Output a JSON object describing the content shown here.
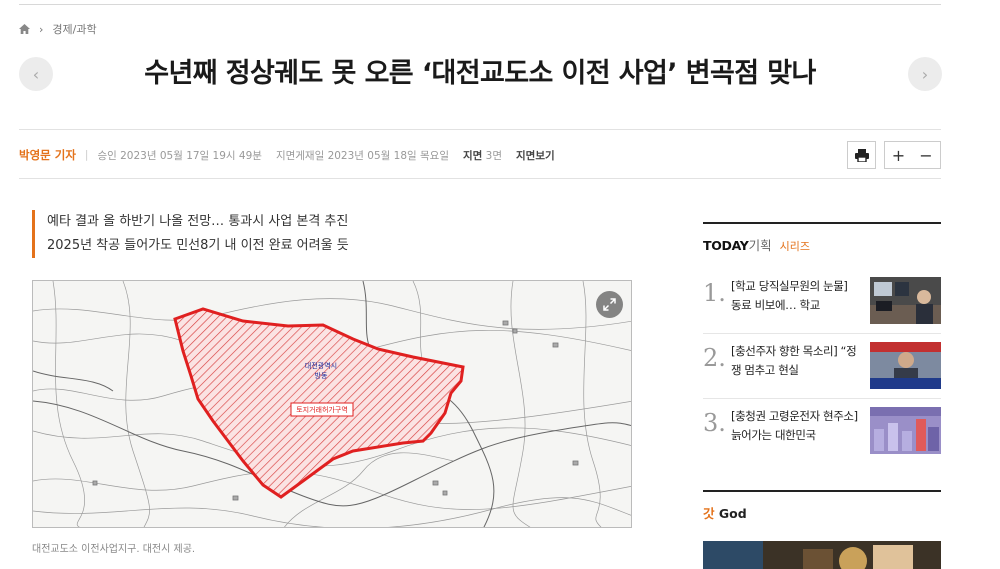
{
  "breadcrumb": {
    "home_icon": "home-icon",
    "separator": "›",
    "section": "경제/과학"
  },
  "article": {
    "title": "수년째 정상궤도 못 오른 ‘대전교도소 이전 사업’ 변곡점 맞나",
    "author": "박영문 기자",
    "meta_sep": "|",
    "approved": "승인 2023년 05월 17일 19시 49분",
    "print_date": "지면게재일 2023년 05월 18일 목요일",
    "page_label": "지면",
    "page_num": "3면",
    "view_print": "지면보기",
    "subtitle_1": "예타 결과 올 하반기 나올 전망… 통과시 사업 본격 추진",
    "subtitle_2": "2025년 착공 들어가도 민선8기 내 이전 완료 어려울 듯",
    "map_label_1": "대전광역시",
    "map_label_2": "방동",
    "map_label_3": "토지거래허가구역",
    "caption": "대전교도소 이전사업지구. 대전시 제공."
  },
  "tools": {
    "print_icon": "printer-icon",
    "plus": "+",
    "minus": "−"
  },
  "nav": {
    "prev": "‹",
    "next": "›"
  },
  "sidebar": {
    "today_1": "TODAY",
    "today_2": "기획",
    "series": "시리즈",
    "items": [
      {
        "num": "1.",
        "text": "[학교 당직실무원의 눈물] 동료 비보에… 학교"
      },
      {
        "num": "2.",
        "text": "[충선주자 향한 목소리] “정쟁 멈추고 현실"
      },
      {
        "num": "3.",
        "text": "[충청권 고령운전자 현주소] 늙어가는 대한민국"
      }
    ],
    "god_1": "갓",
    "god_2": " God"
  },
  "colors": {
    "accent": "#e4721b",
    "boundary": "#e02020"
  }
}
